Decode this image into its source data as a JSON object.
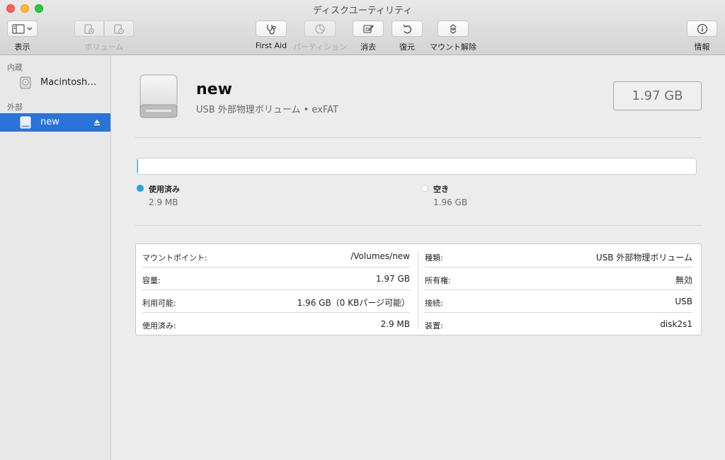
{
  "window": {
    "title": "ディスクユーティリティ"
  },
  "toolbar": {
    "view_label": "表示",
    "volume_label": "ボリューム",
    "first_aid_label": "First Aid",
    "partition_label": "パーティション",
    "erase_label": "消去",
    "restore_label": "復元",
    "unmount_label": "マウント解除",
    "info_label": "情報"
  },
  "sidebar": {
    "internal_header": "内蔵",
    "external_header": "外部",
    "items": [
      {
        "label": "Macintosh…",
        "icon": "internal-disk-icon",
        "selected": false
      },
      {
        "label": "new",
        "icon": "external-disk-icon",
        "selected": true
      }
    ]
  },
  "volume": {
    "name": "new",
    "subtitle": "USB 外部物理ボリューム • exFAT",
    "capacity": "1.97 GB"
  },
  "usage": {
    "used_fraction": 0.0015,
    "used_label": "使用済み",
    "used_value": "2.9 MB",
    "free_label": "空き",
    "free_value": "1.96 GB",
    "used_color": "#1fa7e8",
    "free_color": "#ffffff"
  },
  "info": {
    "left": [
      {
        "key": "マウントポイント:",
        "value": "/Volumes/new"
      },
      {
        "key": "容量:",
        "value": "1.97 GB"
      },
      {
        "key": "利用可能:",
        "value": "1.96 GB（0 KBパージ可能）"
      },
      {
        "key": "使用済み:",
        "value": "2.9 MB"
      }
    ],
    "right": [
      {
        "key": "種類:",
        "value": "USB 外部物理ボリューム"
      },
      {
        "key": "所有権:",
        "value": "無効"
      },
      {
        "key": "接続:",
        "value": "USB"
      },
      {
        "key": "装置:",
        "value": "disk2s1"
      }
    ]
  },
  "colors": {
    "accent": "#2a73d9",
    "used": "#1fa7e8"
  }
}
